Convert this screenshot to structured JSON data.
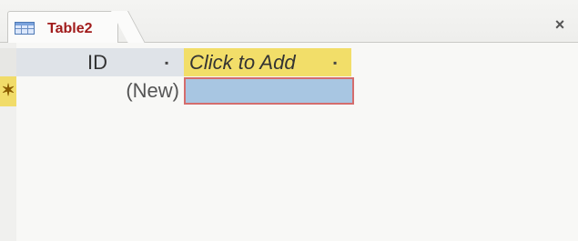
{
  "tab": {
    "title": "Table2",
    "close_symbol": "×",
    "icon": "table-icon"
  },
  "grid": {
    "columns": [
      {
        "label": "ID",
        "sort_symbol": "▪"
      },
      {
        "label": "Click to Add",
        "sort_symbol": "▪"
      }
    ],
    "new_row": {
      "selector": "✶",
      "id_value": "(New)",
      "add_value": ""
    }
  },
  "colors": {
    "tab_text": "#a11b1b",
    "header_highlight": "#f2de69",
    "selected_cell": "#a8c6e2",
    "selected_border": "#d46d6d"
  }
}
